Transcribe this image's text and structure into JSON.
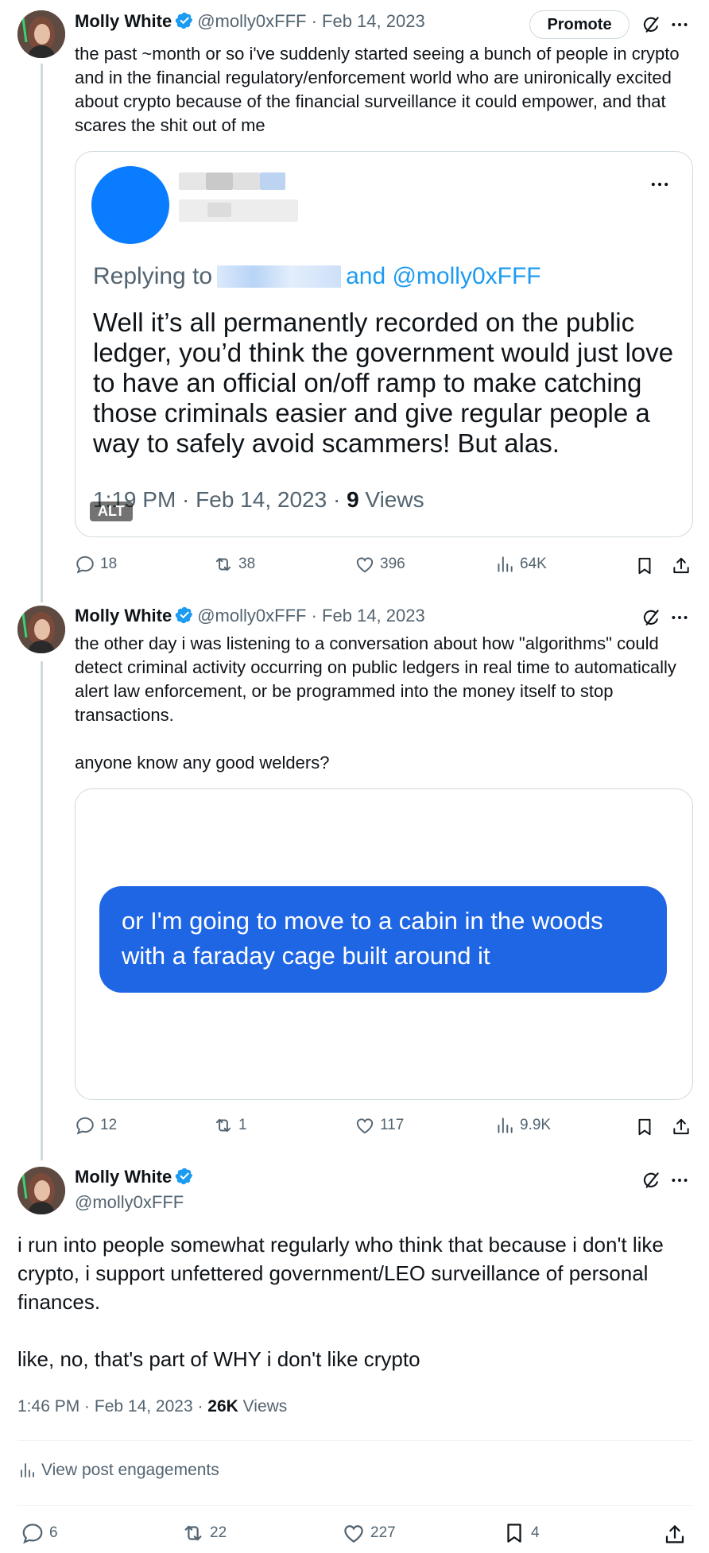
{
  "tweets": [
    {
      "author": "Molly White",
      "handle": "@molly0xFFF",
      "date": "Feb 14, 2023",
      "promote_label": "Promote",
      "text": "the past ~month or so i've suddenly started seeing a bunch of people in crypto and in the financial regulatory/enforcement world who are unironically excited about crypto because of the financial surveillance it could empower, and that scares the shit out of me",
      "embed": {
        "replying_prefix": "Replying to",
        "replying_suffix": "and @molly0xFFF",
        "text": "Well it’s all permanently recorded on the public ledger, you’d think the government would just love to have an official on/off ramp to make catching those criminals easier and give regular people a way to safely avoid scammers! But alas.",
        "time": "1:19 PM · Feb 14, 2023 · ",
        "views_count": "9",
        "views_label": " Views",
        "alt_badge": "ALT"
      },
      "stats": {
        "replies": "18",
        "reposts": "38",
        "likes": "396",
        "views": "64K"
      }
    },
    {
      "author": "Molly White",
      "handle": "@molly0xFFF",
      "date": "Feb 14, 2023",
      "text": "the other day i was listening to a conversation about how \"algorithms\" could detect criminal activity occurring on public ledgers in real time to automatically alert law enforcement, or be programmed into the money itself to stop transactions.\n\nanyone know any good welders?",
      "embed": {
        "bubble_text": "or I'm going to move to a cabin in the woods with a faraday cage built around it"
      },
      "stats": {
        "replies": "12",
        "reposts": "1",
        "likes": "117",
        "views": "9.9K"
      }
    },
    {
      "author": "Molly White",
      "handle": "@molly0xFFF",
      "text": "i run into people somewhat regularly who think that because i don't like crypto, i support unfettered government/LEO surveillance of personal finances.\n\nlike, no, that's part of WHY i don't like crypto",
      "time": "1:46 PM · Feb 14, 2023 · ",
      "views_count": "26K",
      "views_label": " Views",
      "engagements_label": "View post engagements",
      "stats": {
        "replies": "6",
        "reposts": "22",
        "likes": "227",
        "bookmarks": "4"
      }
    }
  ],
  "colors": {
    "accent": "#1d9bf0",
    "bubble": "#1f66e5",
    "muted": "#536471"
  }
}
